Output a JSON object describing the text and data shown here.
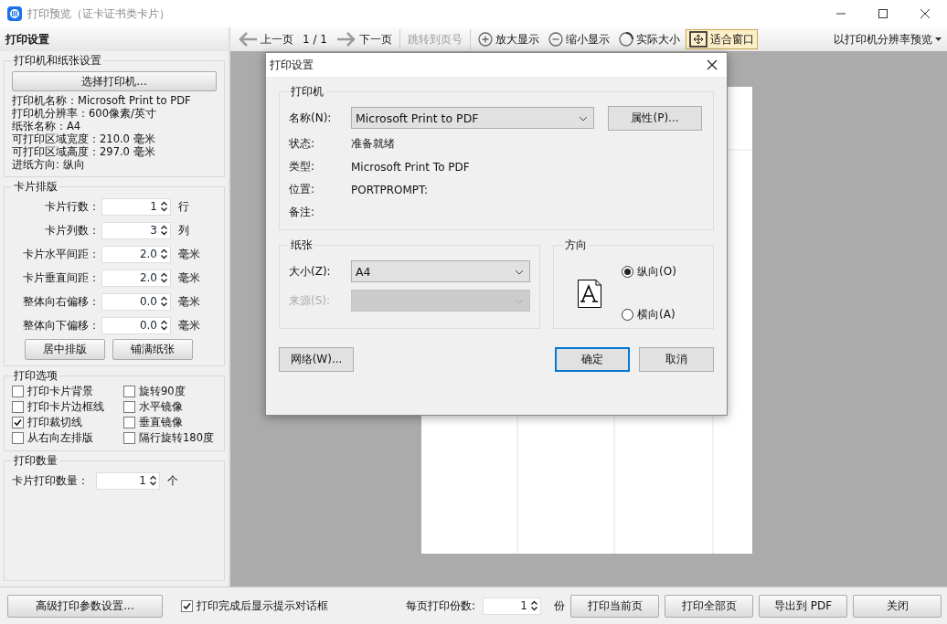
{
  "window": {
    "title": "打印预览（证卡证书类卡片）"
  },
  "left_panel": {
    "title": "打印设置",
    "printer_group": {
      "title": "打印机和纸张设置",
      "button": "选择打印机...",
      "info": [
        "打印机名称：Microsoft Print to PDF",
        "打印机分辨率：600像素/英寸",
        "纸张名称：A4",
        "可打印区域宽度：210.0 毫米",
        "可打印区域高度：297.0 毫米",
        "进纸方向: 纵向"
      ]
    },
    "layout_group": {
      "title": "卡片排版",
      "fields": [
        {
          "label": "卡片行数：",
          "value": "1",
          "unit": "行"
        },
        {
          "label": "卡片列数：",
          "value": "3",
          "unit": "列"
        },
        {
          "label": "卡片水平间距：",
          "value": "2.0",
          "unit": "毫米"
        },
        {
          "label": "卡片垂直间距：",
          "value": "2.0",
          "unit": "毫米"
        },
        {
          "label": "整体向右偏移：",
          "value": "0.0",
          "unit": "毫米"
        },
        {
          "label": "整体向下偏移：",
          "value": "0.0",
          "unit": "毫米"
        }
      ],
      "buttons": [
        "居中排版",
        "铺满纸张"
      ]
    },
    "options_group": {
      "title": "打印选项",
      "options": [
        {
          "label": "打印卡片背景",
          "checked": false
        },
        {
          "label": "旋转90度",
          "checked": false
        },
        {
          "label": "打印卡片边框线",
          "checked": false
        },
        {
          "label": "水平镜像",
          "checked": false
        },
        {
          "label": "打印裁切线",
          "checked": true
        },
        {
          "label": "垂直镜像",
          "checked": false
        },
        {
          "label": "从右向左排版",
          "checked": false
        },
        {
          "label": "隔行旋转180度",
          "checked": false
        }
      ]
    },
    "quantity_group": {
      "title": "打印数量",
      "label": "卡片打印数量：",
      "value": "1",
      "unit": "个"
    }
  },
  "toolbar": {
    "items": [
      {
        "kind": "prev",
        "label": "上一页",
        "disabled": false,
        "selected": false
      },
      {
        "kind": "page",
        "label": "1 / 1"
      },
      {
        "kind": "next",
        "label": "下一页",
        "disabled": false,
        "selected": false
      },
      {
        "kind": "jump",
        "label": "跳转到页号",
        "disabled": true,
        "selected": false
      },
      {
        "kind": "zoom-in",
        "label": "放大显示",
        "disabled": false,
        "selected": false
      },
      {
        "kind": "zoom-out",
        "label": "缩小显示",
        "disabled": false,
        "selected": false
      },
      {
        "kind": "actual-size",
        "label": "实际大小",
        "disabled": false,
        "selected": false
      },
      {
        "kind": "fit",
        "label": "适合窗口",
        "disabled": false,
        "selected": true
      }
    ],
    "preview_mode": "以打印机分辨率预览"
  },
  "dialog": {
    "title": "打印设置",
    "printer": {
      "title": "打印机",
      "name_label": "名称(N):",
      "name_value": "Microsoft Print to PDF",
      "properties_button": "属性(P)...",
      "info": [
        {
          "label": "状态:",
          "value": "准备就绪"
        },
        {
          "label": "类型:",
          "value": "Microsoft Print To PDF"
        },
        {
          "label": "位置:",
          "value": "PORTPROMPT:"
        },
        {
          "label": "备注:"
        }
      ]
    },
    "paper": {
      "title": "纸张",
      "size_label": "大小(Z):",
      "size_value": "A4",
      "source_label": "来源(S):",
      "source_disabled": true
    },
    "orientation": {
      "title": "方向",
      "options": [
        {
          "label": "纵向(O)",
          "selected": true
        },
        {
          "label": "横向(A)",
          "selected": false
        }
      ]
    },
    "network_button": "网络(W)...",
    "ok_button": "确定",
    "cancel_button": "取消"
  },
  "bottom_bar": {
    "advanced_button": "高级打印参数设置...",
    "notify": {
      "label": "打印完成后显示提示对话框",
      "checked": true
    },
    "copies": {
      "label": "每页打印份数:",
      "value": "1",
      "unit": "份"
    },
    "buttons": [
      "打印当前页",
      "打印全部页",
      "导出到 PDF",
      "关闭"
    ]
  }
}
